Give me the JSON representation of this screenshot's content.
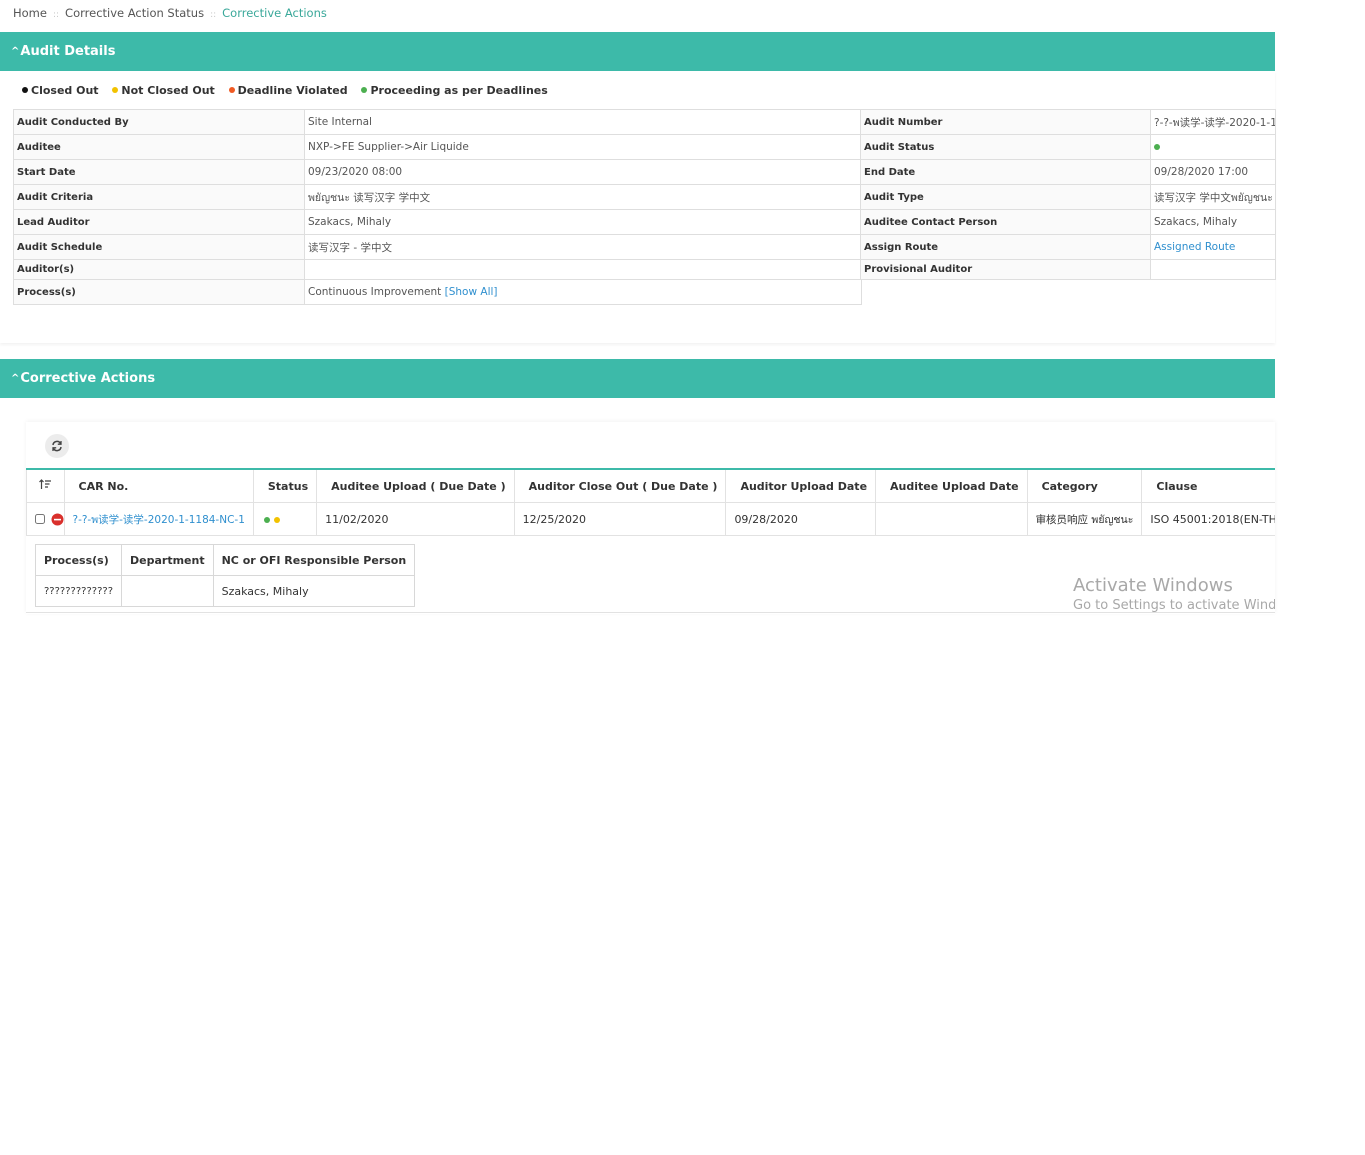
{
  "breadcrumb": {
    "home": "Home",
    "level1": "Corrective Action Status",
    "current": "Corrective Actions"
  },
  "audit_section": {
    "title": "Audit Details",
    "legend": [
      {
        "label": "Closed Out",
        "color": "#111111"
      },
      {
        "label": "Not Closed Out",
        "color": "#f2c200"
      },
      {
        "label": "Deadline Violated",
        "color": "#f05a23"
      },
      {
        "label": "Proceeding as per Deadlines",
        "color": "#4caf50"
      }
    ],
    "fields": {
      "audit_conducted_by": {
        "label": "Audit Conducted By",
        "value": "Site Internal"
      },
      "auditee": {
        "label": "Auditee",
        "value": "NXP->FE Supplier->Air Liquide"
      },
      "start_date": {
        "label": "Start Date",
        "value": "09/23/2020 08:00"
      },
      "audit_criteria": {
        "label": "Audit Criteria",
        "value": "พยัญชนะ 读写汉字 学中文"
      },
      "lead_auditor": {
        "label": "Lead Auditor",
        "value": "Szakacs, Mihaly"
      },
      "audit_schedule": {
        "label": "Audit Schedule",
        "value": "读写汉字 - 学中文"
      },
      "auditors": {
        "label": "Auditor(s)",
        "value": ""
      },
      "processes": {
        "label": "Process(s)",
        "value": "Continuous Improvement",
        "link": "[Show All]"
      },
      "audit_number": {
        "label": "Audit Number",
        "value": "?-?-พ读学-读学-2020-1-1"
      },
      "audit_status": {
        "label": "Audit Status",
        "color": "#4caf50"
      },
      "end_date": {
        "label": "End Date",
        "value": "09/28/2020 17:00"
      },
      "audit_type": {
        "label": "Audit Type",
        "value": "读写汉字 学中文พยัญชนะ"
      },
      "auditee_contact": {
        "label": "Auditee Contact Person",
        "value": "Szakacs, Mihaly"
      },
      "assign_route": {
        "label": "Assign Route",
        "value": "Assigned Route"
      },
      "provisional_auditor": {
        "label": "Provisional Auditor",
        "value": ""
      }
    }
  },
  "ca_section": {
    "title": "Corrective Actions",
    "columns": [
      "CAR No.",
      "Status",
      "Auditee Upload ( Due Date )",
      "Auditor Close Out ( Due Date )",
      "Auditor Upload Date",
      "Auditee Upload Date",
      "Category",
      "Clause"
    ],
    "row": {
      "car_no": "?-?-พ读学-读学-2020-1-1184-NC-1",
      "status_colors": [
        "#4caf50",
        "#f2c200"
      ],
      "auditee_upload_due": "11/02/2020",
      "auditor_close_out_due": "12/25/2020",
      "auditor_upload_date": "09/28/2020",
      "auditee_upload_date": "",
      "category": "审核员响应 พยัญชนะ",
      "clause": "ISO 45001:2018(EN-TH"
    },
    "sub_columns": [
      "Process(s)",
      "Department",
      "NC or OFI Responsible Person"
    ],
    "sub_row": {
      "process": "?????????????",
      "department": "",
      "person": "Szakacs, Mihaly"
    }
  },
  "watermark": {
    "line1": "Activate Windows",
    "line2": "Go to Settings to activate Windows."
  }
}
